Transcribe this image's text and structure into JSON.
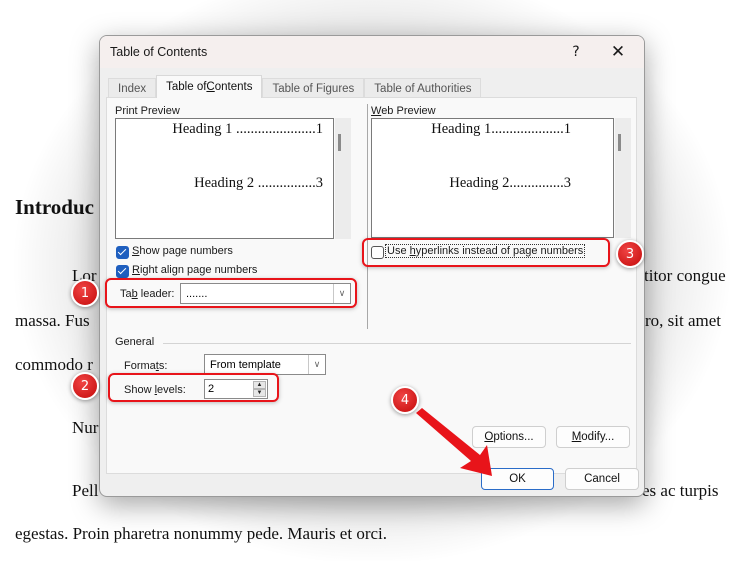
{
  "document": {
    "heading": "Introduc",
    "lines": [
      {
        "left": "Lor",
        "right": "titor congue"
      },
      {
        "left": "massa. Fus",
        "right": "ro, sit amet"
      },
      {
        "left": "commodo r",
        "right": ""
      },
      {
        "left": "Nur",
        "right": ""
      },
      {
        "left": "Pell",
        "right": "es ac turpis"
      },
      {
        "left": "egestas. Proin pharetra nonummy pede. Mauris et orci.",
        "right": ""
      }
    ]
  },
  "dialog": {
    "title": "Table of Contents",
    "help_label": "?",
    "close_label": "✕",
    "tabs": [
      {
        "label": "Index",
        "active": false
      },
      {
        "label": "Table of Contents",
        "active": true
      },
      {
        "label": "Table of Figures",
        "active": false
      },
      {
        "label": "Table of Authorities",
        "active": false
      }
    ],
    "print_preview": {
      "label": "Print Preview",
      "entries": [
        {
          "text": "Heading 1 ......................1"
        },
        {
          "text": "Heading 2 ................3"
        }
      ]
    },
    "web_preview": {
      "label": "Web Preview",
      "entries": [
        {
          "text": "Heading 1....................1"
        },
        {
          "text": "Heading 2...............3"
        }
      ]
    },
    "show_page_numbers": {
      "label": "Show page numbers",
      "checked": true
    },
    "right_align_page_numbers": {
      "label": "Right align page numbers",
      "checked": true
    },
    "tab_leader": {
      "label": "Tab leader:",
      "value": "......."
    },
    "use_hyperlinks": {
      "label": "Use hyperlinks instead of page numbers",
      "checked": false
    },
    "general": {
      "label": "General",
      "formats": {
        "label": "Formats:",
        "value": "From template"
      },
      "show_levels": {
        "label": "Show levels:",
        "value": "2"
      }
    },
    "buttons": {
      "options": "Options...",
      "modify": "Modify...",
      "ok": "OK",
      "cancel": "Cancel"
    }
  },
  "annotations": {
    "badges": [
      "1",
      "2",
      "3",
      "4"
    ],
    "color": "#e8141a"
  }
}
